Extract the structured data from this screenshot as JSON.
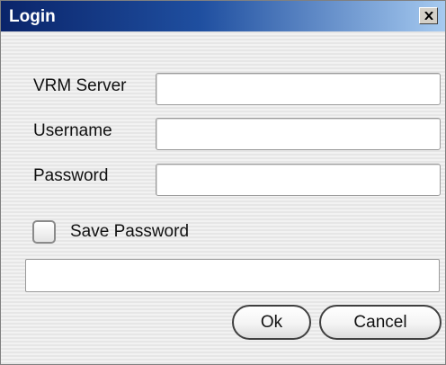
{
  "window": {
    "title": "Login",
    "close_glyph": "X"
  },
  "form": {
    "server_label": "VRM Server",
    "server_value": "",
    "username_label": "Username",
    "username_value": "",
    "password_label": "Password",
    "password_value": "",
    "save_password_label": "Save Password",
    "save_password_checked": false,
    "status_text": ""
  },
  "buttons": {
    "ok_label": "Ok",
    "cancel_label": "Cancel"
  },
  "colors": {
    "titlebar_start": "#0a246a",
    "titlebar_end": "#a6caf0"
  },
  "icons": {
    "close": "close-icon"
  }
}
